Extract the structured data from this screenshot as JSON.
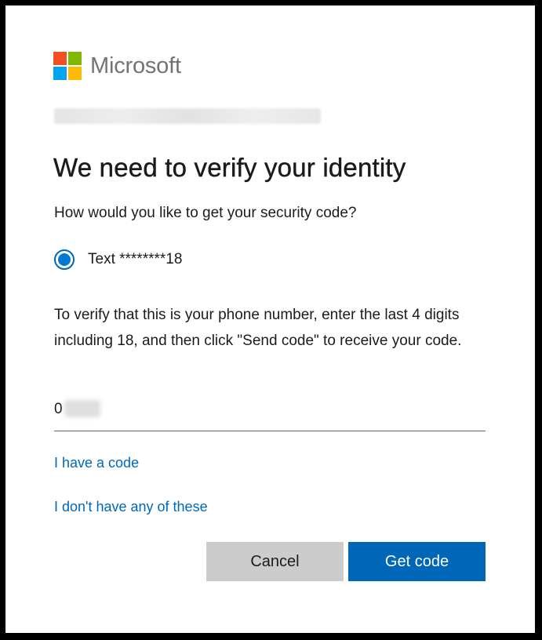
{
  "brand": {
    "name": "Microsoft",
    "colors": {
      "red": "#f25022",
      "green": "#7fba00",
      "blue": "#00a4ef",
      "yellow": "#ffb900",
      "accent": "#0067b8"
    }
  },
  "page": {
    "title": "We need to verify your identity",
    "subtitle": "How would you like to get your security code?"
  },
  "options": [
    {
      "label": "Text ********18",
      "selected": true
    }
  ],
  "instructions": "To verify that this is your phone number, enter the last 4 digits including 18, and then click \"Send code\" to receive your code.",
  "input": {
    "value": "0"
  },
  "links": {
    "have_code": "I have a code",
    "dont_have": "I don't have any of these"
  },
  "buttons": {
    "cancel": "Cancel",
    "get_code": "Get code"
  }
}
